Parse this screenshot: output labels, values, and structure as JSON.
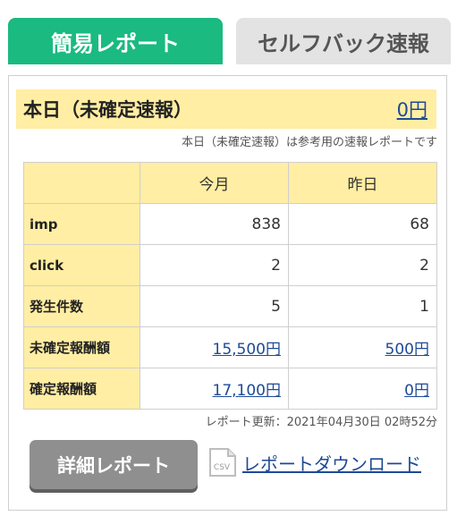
{
  "tabs": {
    "simple_report": "簡易レポート",
    "selfback": "セルフバック速報"
  },
  "today": {
    "title": "本日（未確定速報）",
    "value": "0円",
    "note": "本日（未確定速報）は参考用の速報レポートです"
  },
  "table": {
    "headers": [
      "",
      "今月",
      "昨日"
    ],
    "rows": [
      {
        "label": "imp",
        "month": "838",
        "yesterday": "68"
      },
      {
        "label": "click",
        "month": "2",
        "yesterday": "2"
      },
      {
        "label": "発生件数",
        "month": "5",
        "yesterday": "1"
      },
      {
        "label": "未確定報酬額",
        "month": "15,500円",
        "yesterday": "500円"
      },
      {
        "label": "確定報酬額",
        "month": "17,100円",
        "yesterday": "0円"
      }
    ]
  },
  "updated": "レポート更新：2021年04月30日 02時52分",
  "actions": {
    "detail_report": "詳細レポート",
    "csv_icon_text": "CSV",
    "download": "レポートダウンロード"
  },
  "colors": {
    "accent_green": "#1aba80",
    "highlight_yellow": "#ffeea3",
    "link_blue": "#1e4a96",
    "button_gray": "#8f8f8f"
  }
}
